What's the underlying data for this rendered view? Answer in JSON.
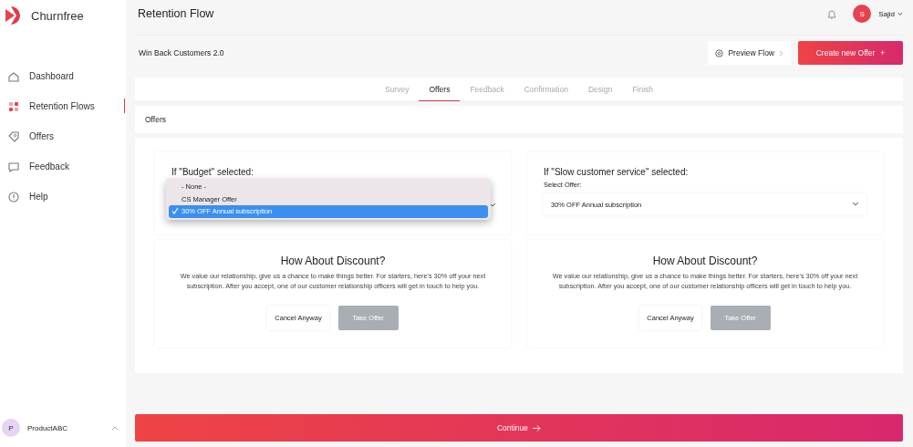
{
  "brand": {
    "name": "Churnfree"
  },
  "sidebar": {
    "items": [
      {
        "label": "Dashboard",
        "selected": false
      },
      {
        "label": "Retention Flows",
        "selected": true
      },
      {
        "label": "Offers",
        "selected": false
      },
      {
        "label": "Feedback",
        "selected": false
      },
      {
        "label": "Help",
        "selected": false
      }
    ],
    "account": {
      "initial": "P",
      "name": "ProductABC"
    }
  },
  "header": {
    "title": "Retention Flow",
    "user": {
      "initial": "S",
      "name": "Sajid"
    }
  },
  "flow": {
    "name": "Win Back Customers 2.0",
    "preview_button": "Preview Flow",
    "create_button": "Create new Offer",
    "create_icon": "+"
  },
  "tabs": [
    {
      "label": "Survey",
      "selected": false
    },
    {
      "label": "Offers",
      "selected": true
    },
    {
      "label": "Feedback",
      "selected": false
    },
    {
      "label": "Confirmation",
      "selected": false
    },
    {
      "label": "Design",
      "selected": false
    },
    {
      "label": "Finish",
      "selected": false
    }
  ],
  "section": {
    "title": "Offers"
  },
  "rules": [
    {
      "heading": "If \"Budget\" selected:",
      "open": true,
      "options": [
        {
          "label": "- None -",
          "selected": false
        },
        {
          "label": "CS Manager Offer",
          "selected": false
        },
        {
          "label": "30% OFF Annual subscription",
          "selected": true
        }
      ]
    },
    {
      "heading": "If \"Slow customer service\" selected:",
      "open": false,
      "select_label": "Select Offer:",
      "value": "30% OFF Annual subscription"
    }
  ],
  "offers": [
    {
      "title": "How About Discount?",
      "body": "We value our relationship, give us a chance to make things better. For starters, here's 30% off your next subscription. After you accept, one of our customer relationship officers will get in touch to help you.",
      "cancel_button": "Cancel Anyway",
      "take_button": "Take Offer",
      "take_disabled": true
    },
    {
      "title": "How About Discount?",
      "body": "We value our relationship, give us a chance to make things better. For starters, here's 30% off your next subscription. After you accept, one of our customer relationship officers will get in touch to help you.",
      "cancel_button": "Cancel Anyway",
      "take_button": "Take Offer",
      "take_disabled": true
    }
  ],
  "continue_button": {
    "label": "Continue"
  }
}
